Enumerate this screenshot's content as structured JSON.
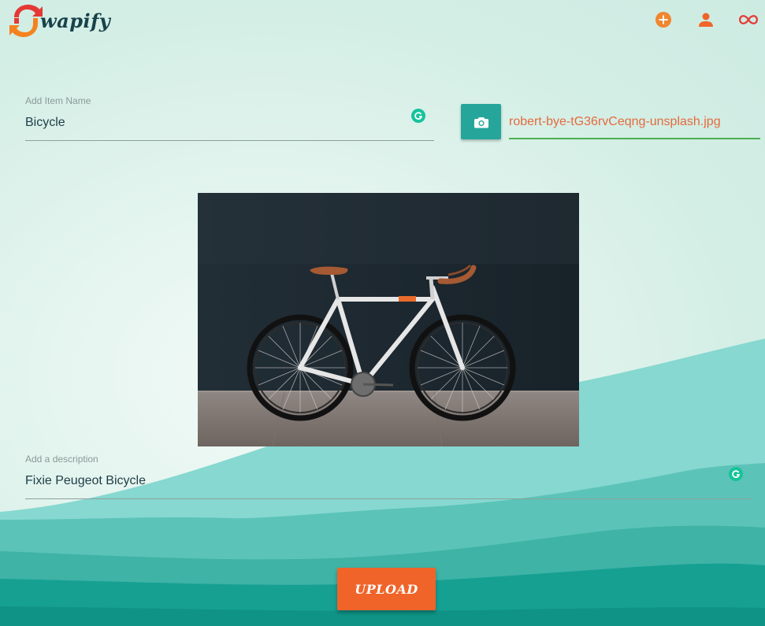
{
  "app": {
    "brand_name": "wapify",
    "brand_colors": {
      "accent_orange": "#f06429",
      "teal": "#26a69a",
      "dark_text": "#17424a",
      "file_text": "#e46a3d",
      "active_line": "#4caf50"
    }
  },
  "header": {
    "icons": [
      {
        "name": "add-circle-icon",
        "color": "#f0862e"
      },
      {
        "name": "person-icon",
        "color": "#f06429"
      },
      {
        "name": "infinity-icon",
        "color": "#e53935"
      }
    ]
  },
  "form": {
    "item_name": {
      "label": "Add Item Name",
      "value": "Bicycle"
    },
    "file": {
      "icon": "camera-icon",
      "file_name": "robert-bye-tG36rvCeqng-unsplash.jpg"
    },
    "description": {
      "label": "Add a description",
      "value": "Fixie Peugeot Bicycle"
    },
    "upload_label": "UPLOAD"
  }
}
